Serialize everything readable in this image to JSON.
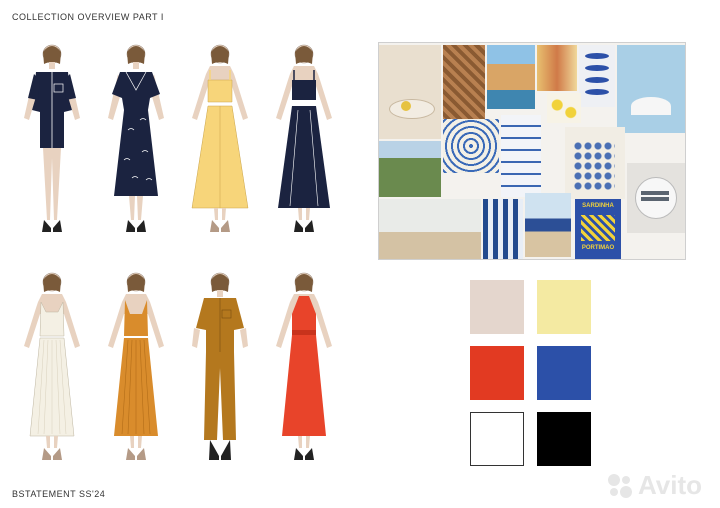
{
  "title": "COLLECTION OVERVIEW PART I",
  "footer": "BSTATEMENT SS'24",
  "watermark": "Avito",
  "palette": {
    "skin": "#e8d2c0",
    "navy": "#1b2340",
    "yellow": "#f7d57a",
    "cream": "#f4f0e4",
    "ochre": "#d98c2c",
    "mustard": "#b4781e",
    "red": "#e8442a"
  },
  "swatches": [
    "#e4d6cd",
    "#f4eaa2",
    "#e23a22",
    "#2c50a8",
    "#ffffff",
    "#000000"
  ],
  "moodboard_tiles": {
    "sardinha_text": "SARDINHA",
    "portimao_text": "PORTIMAO"
  }
}
